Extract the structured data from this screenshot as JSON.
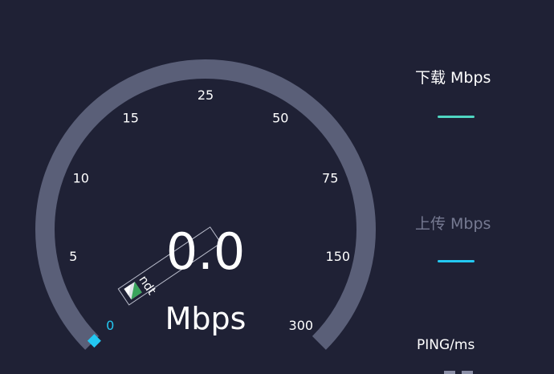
{
  "gauge": {
    "value": 0,
    "value_text": "0.0",
    "unit": "Mbps",
    "ticks": [
      "0",
      "5",
      "10",
      "15",
      "25",
      "50",
      "75",
      "150",
      "300"
    ],
    "arc_color": "#5a5f78",
    "zero_color": "#23c8f2",
    "needle_icon": "speed-test-ndt-icon"
  },
  "panels": {
    "download": {
      "label": "下载 Mbps",
      "accent": "#4fd6c2"
    },
    "upload": {
      "label": "上传 Mbps",
      "accent": "#23c8f2"
    },
    "ping": {
      "label": "PING/ms"
    }
  }
}
